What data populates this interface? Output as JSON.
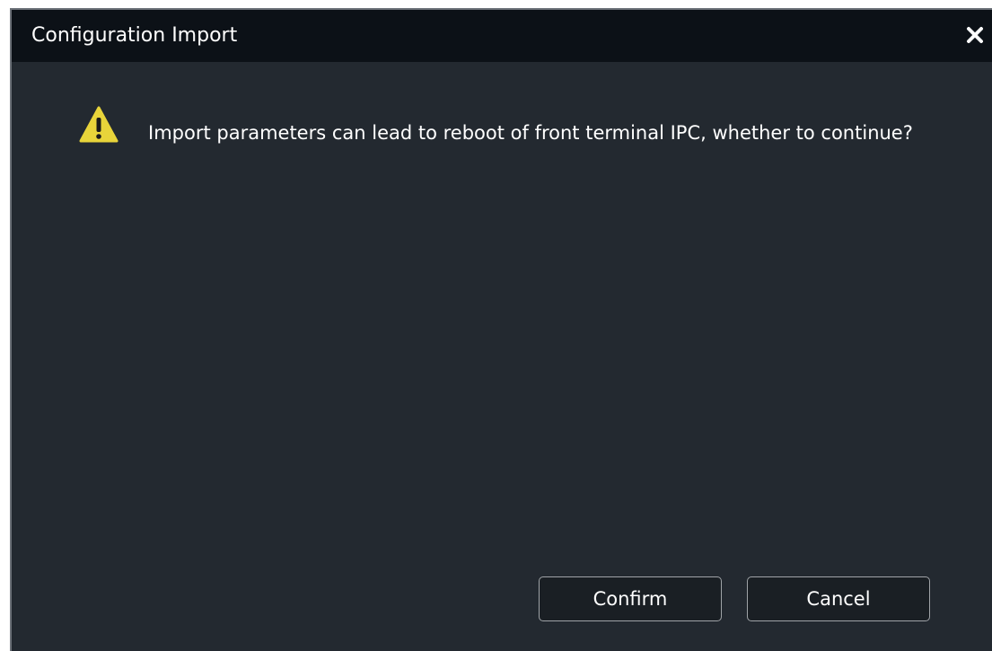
{
  "dialog": {
    "title": "Configuration Import",
    "close_icon": "close-icon",
    "warning_icon": "warning-icon",
    "message": "Import parameters can lead to reboot of  front terminal IPC, whether to continue?",
    "confirm_label": "Confirm",
    "cancel_label": "Cancel"
  },
  "colors": {
    "title_bar": "#0c1117",
    "body": "#232930",
    "warning": "#e8d43a",
    "text": "#ffffff"
  }
}
